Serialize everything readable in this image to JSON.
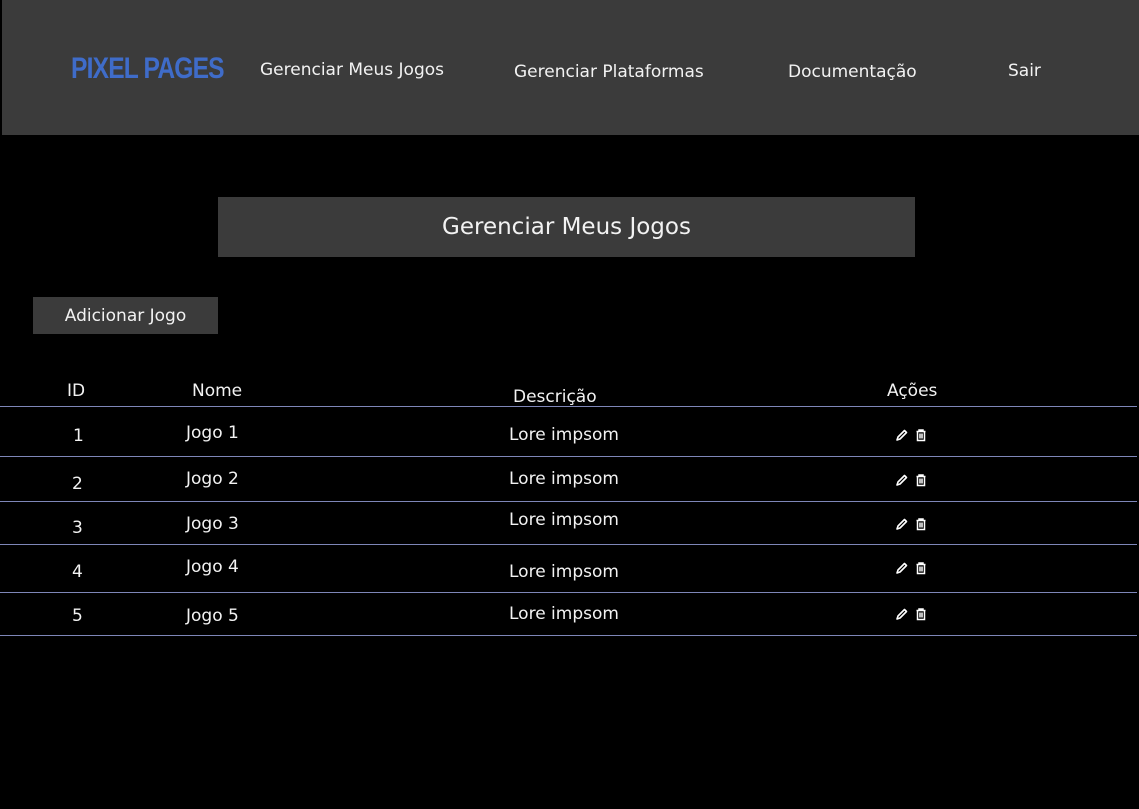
{
  "header": {
    "logo": "PIXEL PAGES",
    "nav": [
      "Gerenciar Meus Jogos",
      "Gerenciar Plataformas",
      "Documentação",
      "Sair"
    ]
  },
  "main": {
    "title": "Gerenciar Meus Jogos",
    "add_button": "Adicionar Jogo"
  },
  "table": {
    "headers": [
      "ID",
      "Nome",
      "Descrição",
      "Ações"
    ],
    "rows": [
      {
        "id": "1",
        "nome": "Jogo 1",
        "descricao": "Lore impsom",
        "actions": [
          "edit-icon",
          "trash-icon"
        ]
      },
      {
        "id": "2",
        "nome": "Jogo 2",
        "descricao": "Lore impsom",
        "actions": [
          "edit-icon",
          "trash-icon"
        ]
      },
      {
        "id": "3",
        "nome": "Jogo 3",
        "descricao": "Lore impsom",
        "actions": [
          "edit-icon",
          "trash-icon"
        ]
      },
      {
        "id": "4",
        "nome": "Jogo 4",
        "descricao": "Lore impsom",
        "actions": [
          "edit-icon",
          "trash-icon"
        ]
      },
      {
        "id": "5",
        "nome": "Jogo 5",
        "descricao": "Lore impsom",
        "actions": [
          "edit-icon",
          "trash-icon"
        ]
      }
    ]
  },
  "colors": {
    "logo": "#3f6cc9",
    "bar": "#3b3b3b",
    "background": "#000000",
    "rule": "#7e86b8"
  }
}
